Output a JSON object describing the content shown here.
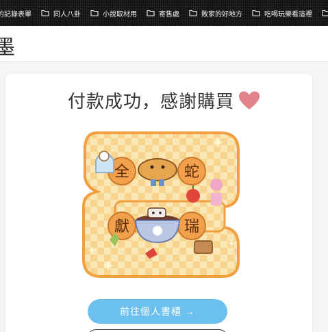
{
  "bookmarks": {
    "items": [
      {
        "label": "的記錄表單",
        "icon": "folder-icon"
      },
      {
        "label": "同人八卦",
        "icon": "folder-icon"
      },
      {
        "label": "小說取材用",
        "icon": "folder-icon"
      },
      {
        "label": "寄售處",
        "icon": "folder-icon"
      },
      {
        "label": "敗家的好地方",
        "icon": "folder-icon"
      },
      {
        "label": "吃喝玩樂看這裡",
        "icon": "folder-icon"
      }
    ]
  },
  "header": {
    "brand_glyph": "墨"
  },
  "main": {
    "title": "付款成功，感謝購買",
    "illustration": {
      "characters": [
        "全",
        "蛇",
        "獻",
        "瑞"
      ]
    },
    "primary_button_label": "前往個人書櫃 →"
  },
  "colors": {
    "heart": "#e0838a",
    "button": "#6cc0f0",
    "board_orange": "#f0a040",
    "board_light": "#f9dfa0"
  }
}
